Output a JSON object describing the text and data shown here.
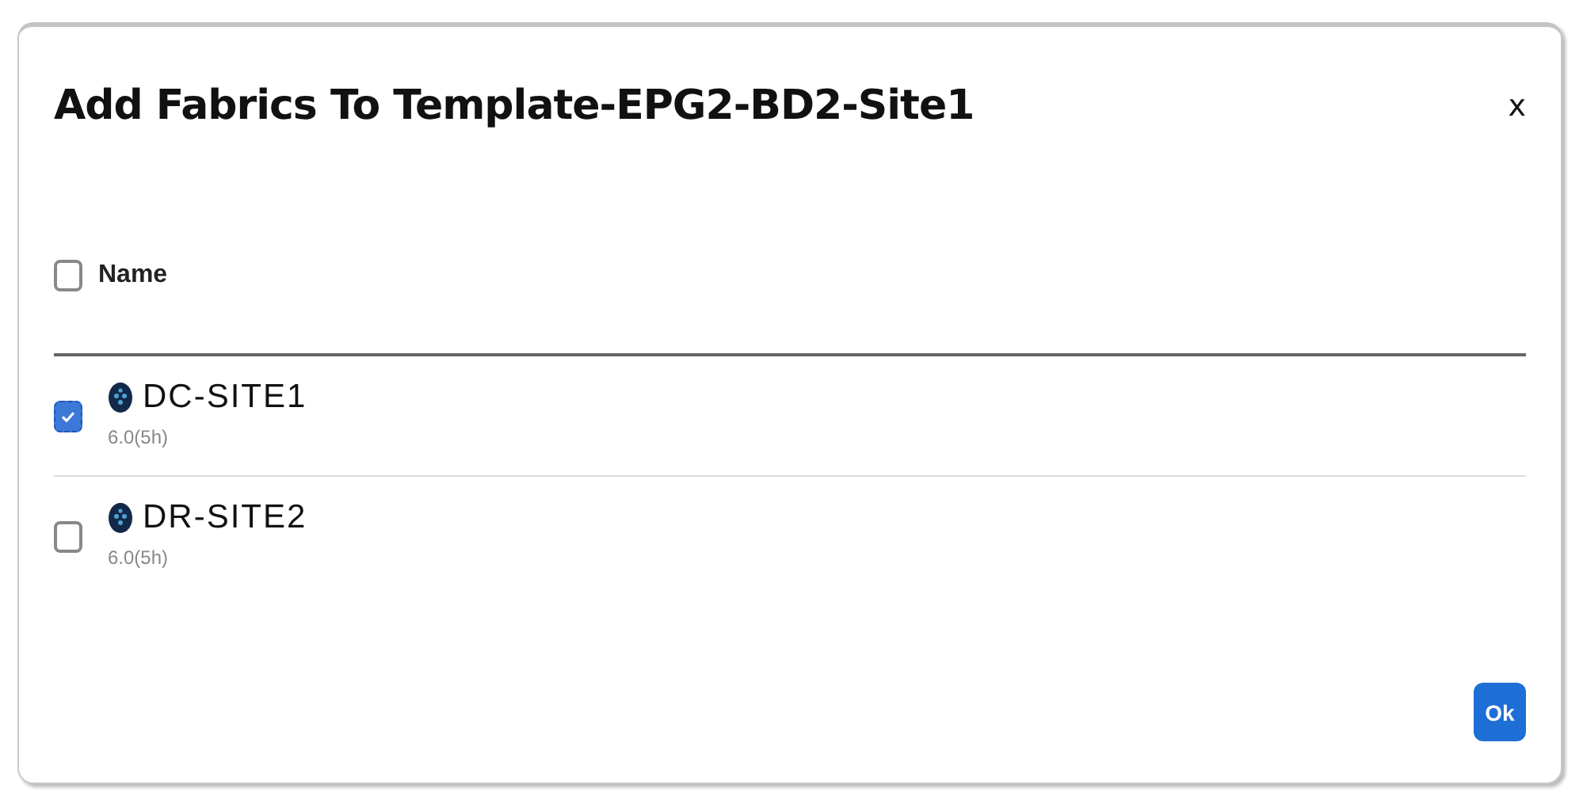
{
  "dialog": {
    "title": "Add Fabrics To Template-EPG2-BD2-Site1",
    "close": "x",
    "table": {
      "header": {
        "label": "Name",
        "checked": false
      },
      "rows": [
        {
          "name": "DC-SITE1",
          "version": "6.0(5h)",
          "checked": true
        },
        {
          "name": "DR-SITE2",
          "version": "6.0(5h)",
          "checked": false
        }
      ]
    },
    "buttons": [
      "Ok"
    ]
  }
}
